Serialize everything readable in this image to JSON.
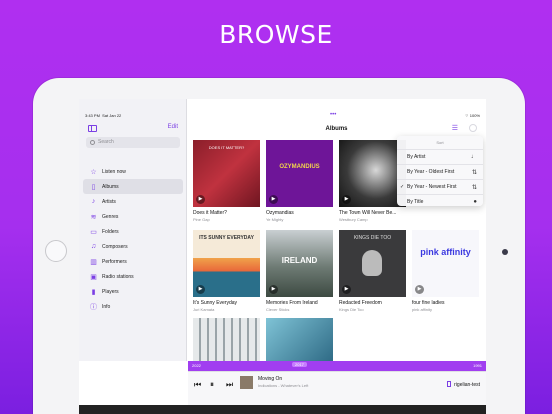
{
  "headline": "BROWSE",
  "status": {
    "time": "3:43 PM",
    "date": "Sat Jan 22",
    "battery": "100%"
  },
  "sidebar": {
    "edit_label": "Edit",
    "search_placeholder": "Search",
    "items": [
      {
        "label": "Listen now",
        "icon": "star-icon"
      },
      {
        "label": "Albums",
        "icon": "albums-icon",
        "active": true
      },
      {
        "label": "Artists",
        "icon": "artists-icon"
      },
      {
        "label": "Genres",
        "icon": "genres-icon"
      },
      {
        "label": "Folders",
        "icon": "folder-icon"
      },
      {
        "label": "Composers",
        "icon": "composers-icon"
      },
      {
        "label": "Performers",
        "icon": "performers-icon"
      },
      {
        "label": "Radio stations",
        "icon": "radio-icon"
      },
      {
        "label": "Players",
        "icon": "players-icon"
      },
      {
        "label": "Info",
        "icon": "info-icon"
      }
    ]
  },
  "main": {
    "title": "Albums",
    "albums": [
      {
        "title": "Does it Matter?",
        "artist": "Pine Gap",
        "art_text": "DOES IT MATTER?"
      },
      {
        "title": "Ozymandias",
        "artist": "Ye Mighty",
        "art_text": "OZYMANDIUS"
      },
      {
        "title": "The Town Will Never Be...",
        "artist": "Westbury Camp",
        "art_text": ""
      },
      {
        "title": "It's Sunny Everyday",
        "artist": "Juri Kamata",
        "art_text": "ITS SUNNY EVERYDAY"
      },
      {
        "title": "Memories From Ireland",
        "artist": "Clever Sticks",
        "art_text": "IRELAND"
      },
      {
        "title": "Redacted Freedom",
        "artist": "Kings Die Too",
        "art_text": "KINGS DIE TOO"
      },
      {
        "title": "four fine ladies",
        "artist": "pink affinity",
        "art_text": "pink affinity"
      },
      {
        "title": "",
        "artist": "",
        "art_text": ""
      },
      {
        "title": "",
        "artist": "",
        "art_text": ""
      }
    ]
  },
  "sort_menu": {
    "header": "Sort",
    "items": [
      {
        "label": "By Artist",
        "checked": false
      },
      {
        "label": "By Year - Oldest First",
        "checked": false
      },
      {
        "label": "By Year - Newest First",
        "checked": true
      },
      {
        "label": "By Title",
        "checked": false
      }
    ]
  },
  "timeline": {
    "start": "2022",
    "mid": "2017",
    "end": "1991"
  },
  "player": {
    "label": "Moving On",
    "track": "Indications - Whatever's Left",
    "output": "rigelian-test"
  }
}
